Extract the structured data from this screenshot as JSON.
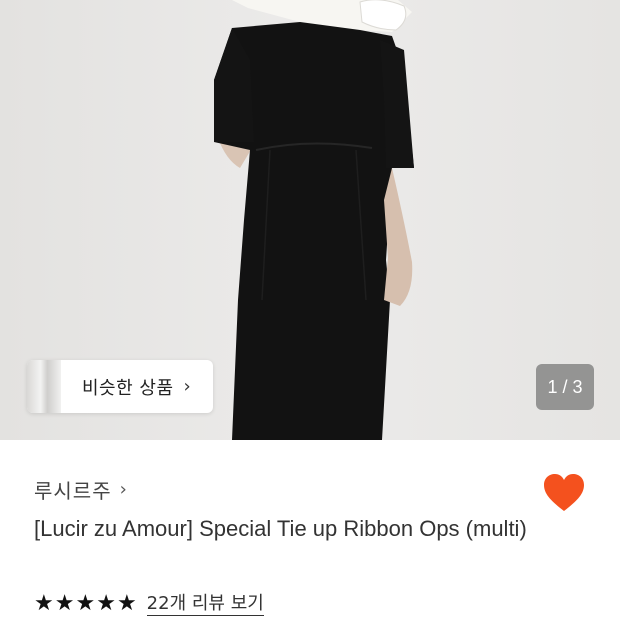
{
  "image_viewer": {
    "similar_button_label": "비슷한 상품",
    "similar_chevron": "›",
    "page_counter": "1 / 3"
  },
  "product": {
    "brand": "루시르주",
    "brand_chevron": "›",
    "title": "[Lucir zu Amour] Special Tie up Ribbon Ops (multi)",
    "wishlisted": true,
    "rating": {
      "stars": 5,
      "star_glyph": "★",
      "review_link": "22개 리뷰 보기"
    }
  },
  "colors": {
    "heart": "#f4511e",
    "stars": "#111111"
  },
  "icons": {
    "heart": "heart-icon",
    "chevron": "chevron-right-icon",
    "star": "star-icon"
  }
}
